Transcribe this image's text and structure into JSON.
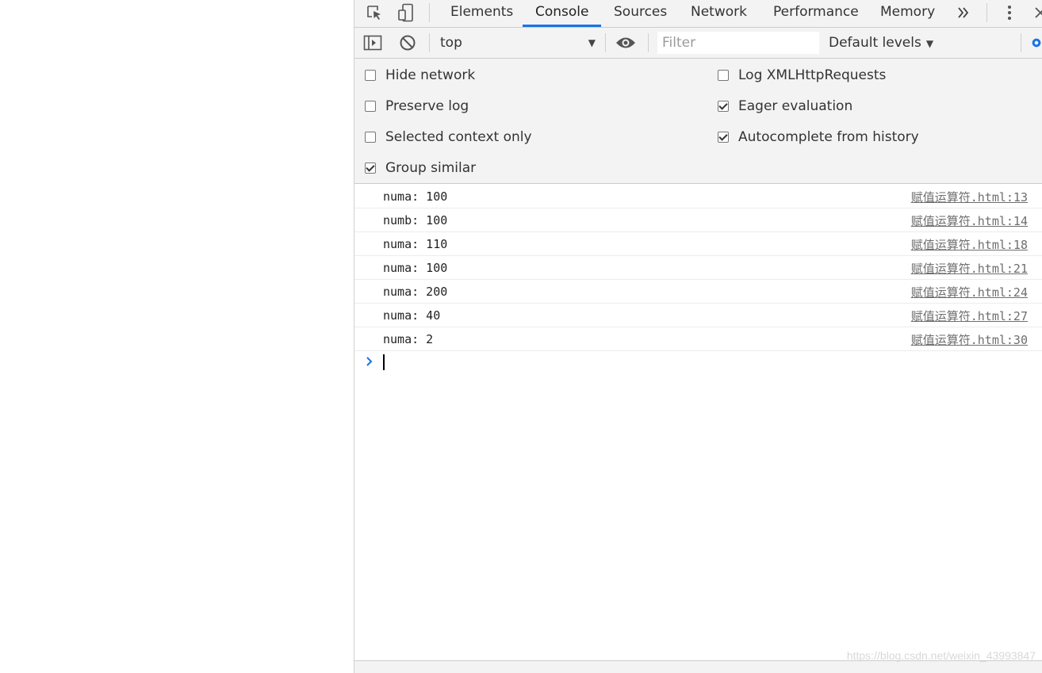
{
  "tabs": [
    {
      "label": "Elements",
      "active": false
    },
    {
      "label": "Console",
      "active": true
    },
    {
      "label": "Sources",
      "active": false
    },
    {
      "label": "Network",
      "active": false
    },
    {
      "label": "Performance",
      "active": false
    },
    {
      "label": "Memory",
      "active": false
    }
  ],
  "toolbar": {
    "context": "top",
    "filter_placeholder": "Filter",
    "levels": "Default levels"
  },
  "settings": {
    "hide_network": {
      "label": "Hide network",
      "checked": false
    },
    "preserve_log": {
      "label": "Preserve log",
      "checked": false
    },
    "selected_context_only": {
      "label": "Selected context only",
      "checked": false
    },
    "group_similar": {
      "label": "Group similar",
      "checked": true
    },
    "log_xhr": {
      "label": "Log XMLHttpRequests",
      "checked": false
    },
    "eager_evaluation": {
      "label": "Eager evaluation",
      "checked": true
    },
    "autocomplete_history": {
      "label": "Autocomplete from history",
      "checked": true
    }
  },
  "messages": [
    {
      "text": "numa: 100",
      "source": "赋值运算符.html:13"
    },
    {
      "text": "numb: 100",
      "source": "赋值运算符.html:14"
    },
    {
      "text": "numa: 110",
      "source": "赋值运算符.html:18"
    },
    {
      "text": "numa: 100",
      "source": "赋值运算符.html:21"
    },
    {
      "text": "numa: 200",
      "source": "赋值运算符.html:24"
    },
    {
      "text": "numa: 40",
      "source": "赋值运算符.html:27"
    },
    {
      "text": "numa: 2",
      "source": "赋值运算符.html:30"
    }
  ],
  "watermark": "https://blog.csdn.net/weixin_43993847",
  "colors": {
    "accent": "#1a73e8",
    "panel_bg": "#f3f3f3",
    "prompt": "#1a73e8"
  }
}
